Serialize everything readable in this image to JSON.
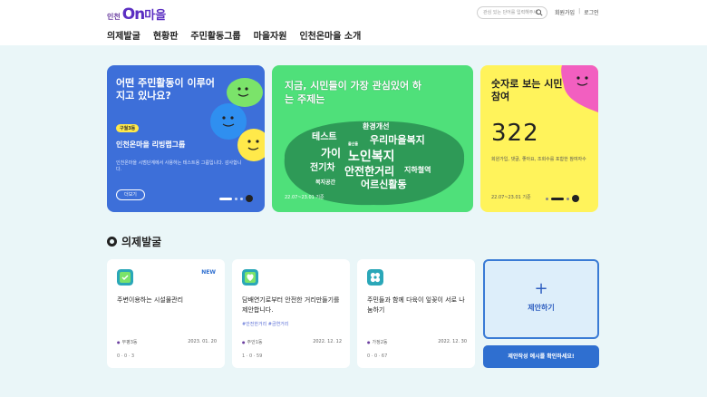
{
  "header": {
    "logo_small": "인천",
    "logo_on": "On",
    "logo_main": "마을",
    "search_placeholder": "관심 있는 단어를 입력해주세요",
    "signup": "회원가입",
    "login": "로그인",
    "nav": [
      "의제발굴",
      "현황판",
      "주민활동그룹",
      "마을자원",
      "인천온마을 소개"
    ]
  },
  "banners": {
    "activity": {
      "title": "어떤 주민활동이 이루어지고 있나요?",
      "badge": "구월3동",
      "subtitle": "인천온마을 리빙랩그룹",
      "description": "인천온마을 시범단계에서 사용하는 테스트용 그룹입니다. 감사합니다.",
      "button": "더보기",
      "colors": {
        "bg": "#3d6fd9",
        "accent": "#ffe94a",
        "blob1": "#7be36a",
        "blob2": "#2f8ff0",
        "blob3": "#ffe94a"
      }
    },
    "topics": {
      "title": "지금, 시민들이 가장 관심있어 하는 주제는",
      "keywords": [
        "환경개선",
        "테스트",
        "우리마을복지",
        "가이",
        "노인복지",
        "전기차",
        "안전한거리",
        "지하철역",
        "복지공간",
        "어르신활동",
        "출산율"
      ],
      "date": "22.07~23.01 기준"
    },
    "participation": {
      "title": "숫자로 보는 시민참여",
      "number": "322",
      "description": "회원가입, 댓글, 좋아요, 조회수를 포함한 참여자수",
      "date": "22.07~23.01 기준"
    }
  },
  "section": {
    "title": "의제발굴"
  },
  "agendas": [
    {
      "title": "주변이용하는 시설물관리",
      "new_badge": "NEW",
      "tags": "",
      "location": "부평3동",
      "date": "2023. 01. 20",
      "stats": "0 · 0 · 3",
      "icon": "shield-check-icon",
      "icon_color": "#2aa7b8"
    },
    {
      "title": "담배연기로부터 안전한 거리만들기를 제안합니다.",
      "new_badge": "",
      "tags": "#안전한거리 #금연거리",
      "location": "주안1동",
      "date": "2022. 12. 12",
      "stats": "1 · 0 · 59",
      "icon": "heart-icon",
      "icon_color": "#2aa7b8"
    },
    {
      "title": "주민들과 함께 다육이 잎꽂이 서로 나눔하기",
      "new_badge": "",
      "tags": "",
      "location": "가정2동",
      "date": "2022. 12. 30",
      "stats": "0 · 0 · 67",
      "icon": "flower-icon",
      "icon_color": "#2aa7b8"
    }
  ],
  "propose": {
    "plus": "+",
    "label": "제안하기"
  },
  "example_button": "제안작성 예시를 확인하세요!"
}
